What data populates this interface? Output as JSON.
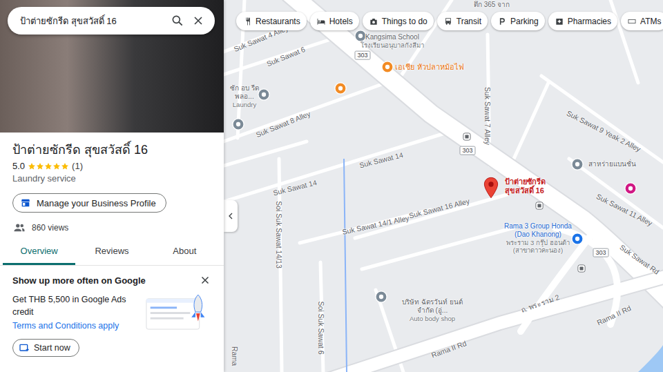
{
  "search": {
    "query": "ป้าต่ายซักรีด สุขสวัสดิ์ 16"
  },
  "place": {
    "name": "ป้าต่ายซักรีด สุขสวัสดิ์ 16",
    "rating": "5.0",
    "stars": 5,
    "review_count": "(1)",
    "category": "Laundry service",
    "manage_button": "Manage your Business Profile",
    "views": "860 views"
  },
  "tabs": [
    {
      "label": "Overview",
      "selected": true
    },
    {
      "label": "Reviews",
      "selected": false
    },
    {
      "label": "About",
      "selected": false
    }
  ],
  "promo": {
    "title": "Show up more often on Google",
    "text": "Get THB 5,500 in Google Ads credit",
    "link": "Terms and Conditions apply",
    "button": "Start now"
  },
  "chips": [
    {
      "label": "Restaurants"
    },
    {
      "label": "Hotels"
    },
    {
      "label": "Things to do"
    },
    {
      "label": "Transit"
    },
    {
      "label": "Parking"
    },
    {
      "label": "Pharmacies"
    },
    {
      "label": "ATMs"
    }
  ],
  "map": {
    "labels": [
      {
        "kind": "street",
        "lines": [
          "Suk Sawat 4 Alley"
        ]
      },
      {
        "kind": "street",
        "lines": [
          "Suk Sawat 6"
        ]
      },
      {
        "kind": "place",
        "lines": [
          "ซัก อบ รีด พลอ...",
          "Laundry"
        ]
      },
      {
        "kind": "street",
        "lines": [
          "Suk Sawat 8 Alley"
        ]
      },
      {
        "kind": "street",
        "lines": [
          "Suk Sawat 14"
        ]
      },
      {
        "kind": "street",
        "lines": [
          "Suk Sawat 14"
        ]
      },
      {
        "kind": "street",
        "lines": [
          "Suk Sawat 14/1 Alley"
        ]
      },
      {
        "kind": "street",
        "lines": [
          "Suk Sawat 16 Alley"
        ]
      },
      {
        "kind": "street",
        "lines": [
          "Soi Suk Sawat 14/13"
        ]
      },
      {
        "kind": "street",
        "lines": [
          "Soi Suk Sawat 6"
        ]
      },
      {
        "kind": "street",
        "lines": [
          "Suk Sawat 7 Alley"
        ]
      },
      {
        "kind": "street",
        "lines": [
          "Suk Sawat 9 Yeak 2 Alley"
        ]
      },
      {
        "kind": "street",
        "lines": [
          "Suk Sawat 11 Alley"
        ]
      },
      {
        "kind": "street",
        "lines": [
          "Suk Sawat Rd"
        ]
      },
      {
        "kind": "street",
        "lines": [
          "Rama II Rd"
        ]
      },
      {
        "kind": "street",
        "lines": [
          "Rama II Rd"
        ]
      },
      {
        "kind": "street",
        "lines": [
          "ถ. พระราม 2"
        ]
      },
      {
        "kind": "street",
        "lines": [
          "Rama"
        ]
      },
      {
        "kind": "food",
        "lines": [
          "เอเชีย หัวปลาหม้อไฟ"
        ]
      },
      {
        "kind": "place",
        "lines": [
          "Kangsima School",
          "โรงเรียนอนุบาลกังสีมา"
        ]
      },
      {
        "kind": "place",
        "lines": [
          "ตึก 365 จาก"
        ]
      },
      {
        "kind": "pin",
        "lines": [
          "ป้าต่ายซักรีด",
          "สุขสวัสดิ์ 16"
        ]
      },
      {
        "kind": "place",
        "lines": [
          "สาหร่ายแบนชั่น"
        ]
      },
      {
        "kind": "business",
        "lines": [
          "Rama 3 Group Honda (Dao Khanong)",
          "พระราม 3 กรุ๊ป ฮอนด้า (สาขาดาวคะนอง)"
        ]
      },
      {
        "kind": "place",
        "lines": [
          "บริษัท ฉัตรวันท์ ยนต์ จำกัด (อู่...",
          "Auto body shop"
        ]
      },
      {
        "kind": "shield",
        "lines": [
          "303"
        ]
      },
      {
        "kind": "shield",
        "lines": [
          "303"
        ]
      },
      {
        "kind": "shield",
        "lines": [
          "303"
        ]
      }
    ]
  }
}
